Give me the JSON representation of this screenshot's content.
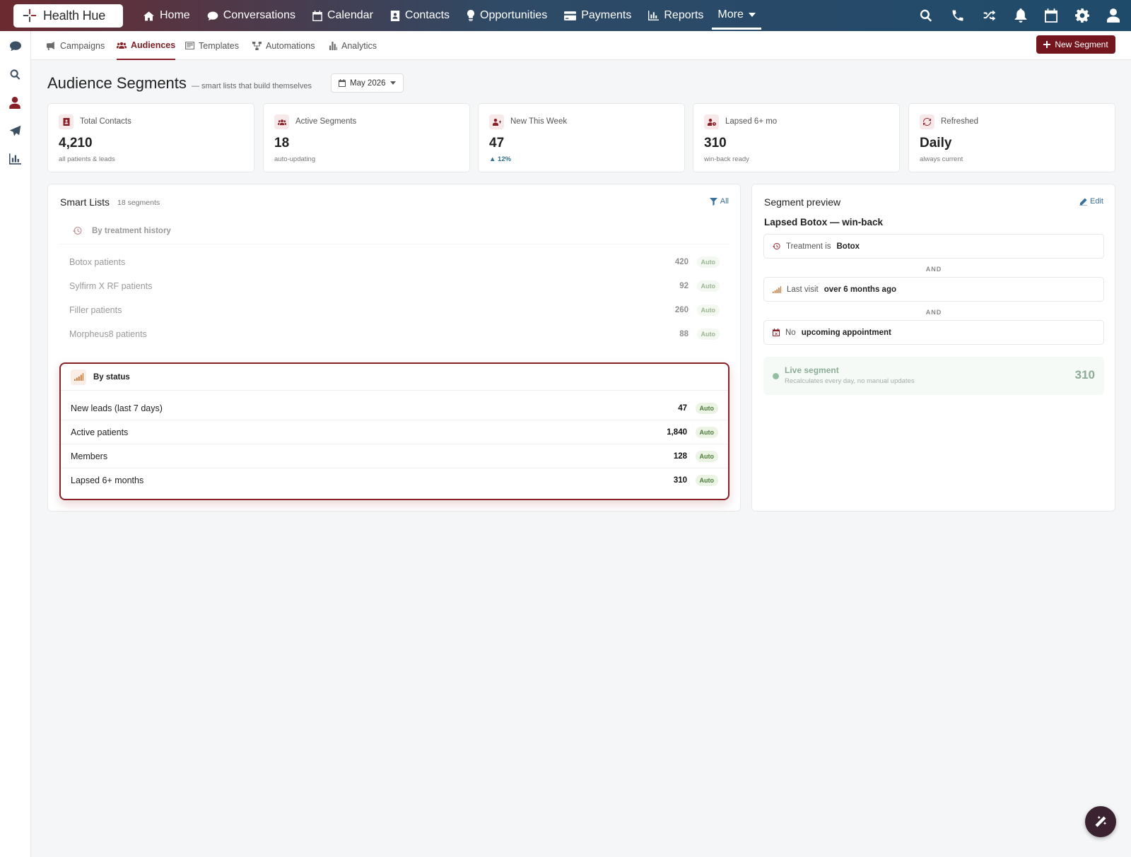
{
  "app": {
    "brand": "Health Hue"
  },
  "nav": {
    "items": [
      "Home",
      "Conversations",
      "Calendar",
      "Contacts",
      "Opportunities",
      "Payments",
      "Reports",
      "More"
    ]
  },
  "subnav": {
    "tabs": [
      "Campaigns",
      "Audiences",
      "Templates",
      "Automations",
      "Analytics"
    ],
    "active": "Audiences",
    "new_button": "New Segment"
  },
  "header": {
    "title": "Audience Segments",
    "subtitle": "— smart lists that build themselves",
    "period": "May 2026"
  },
  "stats": [
    {
      "label": "Total Contacts",
      "value": "4,210",
      "sub": "all patients & leads"
    },
    {
      "label": "Active Segments",
      "value": "18",
      "sub": "auto-updating"
    },
    {
      "label": "New This Week",
      "value": "47",
      "sub": "▲ 12%"
    },
    {
      "label": "Lapsed 6+ mo",
      "value": "310",
      "sub": "win-back ready"
    },
    {
      "label": "Refreshed",
      "value": "Daily",
      "sub": "always current"
    }
  ],
  "smart_lists": {
    "title": "Smart Lists",
    "count": "18 segments",
    "filter": "All",
    "groups": [
      {
        "title": "By treatment history",
        "rows": [
          {
            "name": "Botox patients",
            "count": "420",
            "badge": "Auto"
          },
          {
            "name": "Sylfirm X RF patients",
            "count": "92",
            "badge": "Auto"
          },
          {
            "name": "Filler patients",
            "count": "260",
            "badge": "Auto"
          },
          {
            "name": "Morpheus8 patients",
            "count": "88",
            "badge": "Auto"
          }
        ]
      },
      {
        "title": "By status",
        "rows": [
          {
            "name": "New leads (last 7 days)",
            "count": "47",
            "badge": "Auto"
          },
          {
            "name": "Active patients",
            "count": "1,840",
            "badge": "Auto"
          },
          {
            "name": "Members",
            "count": "128",
            "badge": "Auto"
          },
          {
            "name": "Lapsed 6+ months",
            "count": "310",
            "badge": "Auto"
          }
        ]
      }
    ]
  },
  "preview": {
    "title": "Segment preview",
    "edit": "Edit",
    "segment_name": "Lapsed Botox — win-back",
    "rules": [
      {
        "prefix": "Treatment is",
        "value": "Botox"
      },
      {
        "prefix": "Last visit",
        "value": "over 6 months ago"
      },
      {
        "prefix": "No",
        "value": "upcoming appointment"
      }
    ],
    "joiner": "AND",
    "live": {
      "title": "Live segment",
      "sub": "Recalculates every day, no manual updates",
      "count": "310"
    }
  },
  "colors": {
    "accent": "#8a2027",
    "primary_button": "#74161d",
    "link": "#3a6f9a"
  }
}
